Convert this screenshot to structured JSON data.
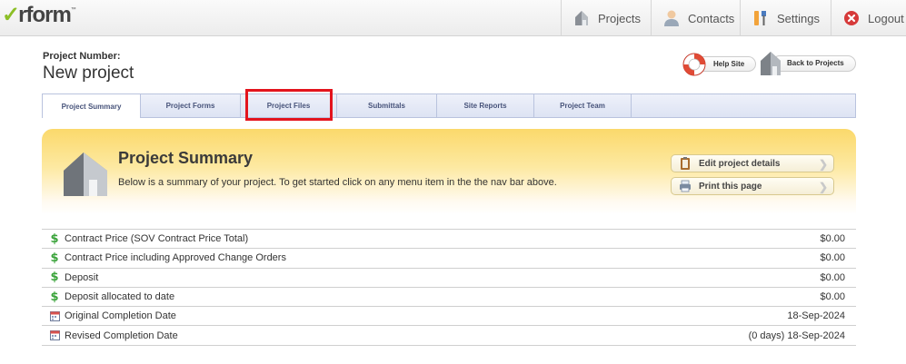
{
  "app": {
    "logo_check": "✓",
    "logo_word": "rform",
    "logo_tm": "™"
  },
  "topnav": {
    "items": [
      {
        "label": "Projects",
        "icon": "house-icon"
      },
      {
        "label": "Contacts",
        "icon": "person-icon"
      },
      {
        "label": "Settings",
        "icon": "tools-icon"
      },
      {
        "label": "Logout",
        "icon": "logout-icon"
      }
    ]
  },
  "project": {
    "number_label": "Project Number:",
    "name": "New project"
  },
  "header_buttons": {
    "help": "Help Site",
    "back": "Back to Projects"
  },
  "tabs": [
    {
      "label": "Project Summary",
      "active": true
    },
    {
      "label": "Project Forms"
    },
    {
      "label": "Project Files",
      "highlighted": true
    },
    {
      "label": "Submittals"
    },
    {
      "label": "Site Reports"
    },
    {
      "label": "Project Team"
    }
  ],
  "banner": {
    "title": "Project Summary",
    "description": "Below is a summary of your project. To get started click on any menu item in the the nav bar above.",
    "edit_label": "Edit project details",
    "print_label": "Print this page"
  },
  "summary_rows": [
    {
      "icon": "dollar-icon",
      "label": "Contract Price (SOV Contract Price Total)",
      "value": "$0.00"
    },
    {
      "icon": "dollar-icon",
      "label": "Contract Price including Approved Change Orders",
      "value": "$0.00"
    },
    {
      "icon": "dollar-icon",
      "label": "Deposit",
      "value": "$0.00"
    },
    {
      "icon": "dollar-icon",
      "label": "Deposit allocated to date",
      "value": "$0.00"
    },
    {
      "icon": "calendar-icon",
      "label": "Original Completion Date",
      "value": "18-Sep-2024"
    },
    {
      "icon": "calendar-icon",
      "label": "Revised Completion Date",
      "value": "(0 days) 18-Sep-2024"
    }
  ],
  "colors": {
    "highlight": "#e3141d",
    "banner_top": "#fbd96b",
    "dollar": "#3aa33a"
  }
}
